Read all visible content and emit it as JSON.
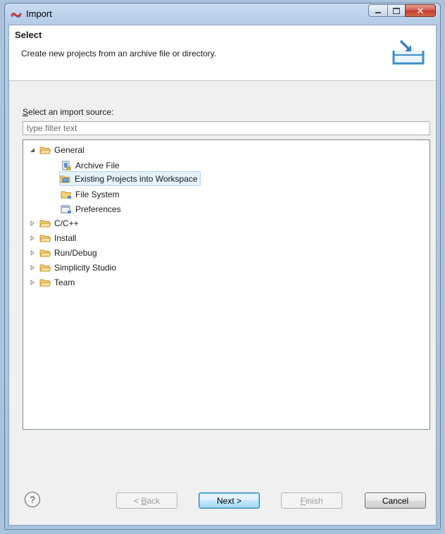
{
  "window": {
    "title": "Import"
  },
  "header": {
    "title": "Select",
    "description": "Create new projects from an archive file or directory.",
    "icon": "import-wizard-icon"
  },
  "source": {
    "label_mnemonic": "S",
    "label_rest": "elect an import source:",
    "filter_placeholder": "type filter text"
  },
  "tree": {
    "general": {
      "label": "General",
      "expanded": true,
      "icon": "folder-open-icon",
      "children": [
        {
          "label": "Archive File",
          "icon": "archive-file-icon"
        },
        {
          "label": "Existing Projects into Workspace",
          "icon": "projects-icon",
          "selected": true
        },
        {
          "label": "File System",
          "icon": "folder-icon"
        },
        {
          "label": "Preferences",
          "icon": "preferences-icon"
        }
      ]
    },
    "collapsed": [
      {
        "label": "C/C++"
      },
      {
        "label": "Install"
      },
      {
        "label": "Run/Debug"
      },
      {
        "label": "Simplicity Studio"
      },
      {
        "label": "Team"
      }
    ]
  },
  "buttons": {
    "back_prefix": "< ",
    "back_mnemonic": "B",
    "back_rest": "ack",
    "next": "Next >",
    "finish_mnemonic": "F",
    "finish_rest": "inish",
    "cancel": "Cancel"
  },
  "colors": {
    "title_gradient": "#b3cbe6",
    "close_button": "#c13b2b",
    "selection": "#e5f1fb",
    "folder": "#e8b84a"
  }
}
